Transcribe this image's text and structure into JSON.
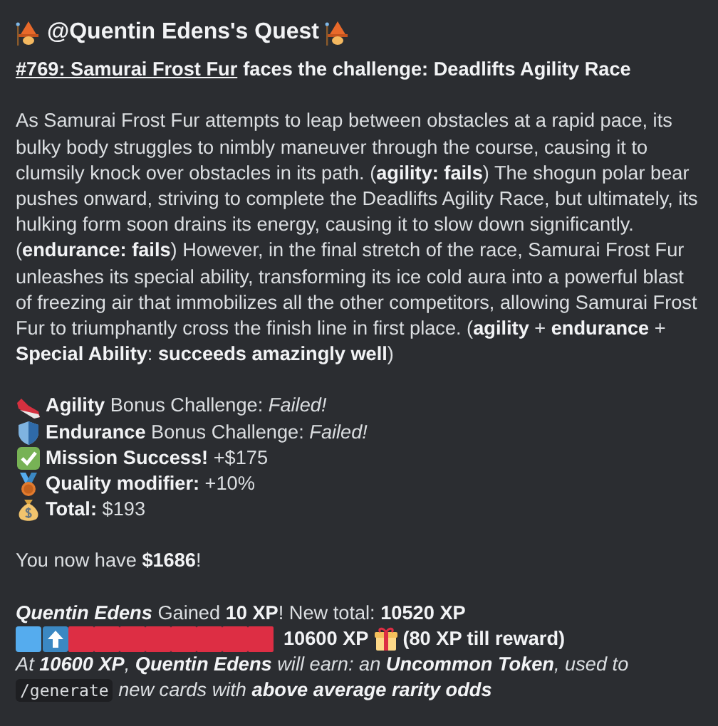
{
  "title": {
    "text": "@Quentin Edens's Quest"
  },
  "heading": {
    "link": "#769: Samurai Frost Fur",
    "text": "faces the challenge: Deadlifts Agility Race"
  },
  "story": "As Samurai Frost Fur attempts to leap between obstacles at a rapid pace, its bulky body struggles to nimbly maneuver through the course, causing it to clumsily knock over obstacles in its path. (**agility: fails**) The shogun polar bear pushes onward, striving to complete the Deadlifts Agility Race, but ultimately, its hulking form soon drains its energy, causing it to slow down significantly. (**endurance: fails**) However, in the final stretch of the race, Samurai Frost Fur unleashes its special ability, transforming its ice cold aura into a powerful blast of freezing air that immobilizes all the other competitors, allowing Samurai Frost Fur to triumphantly cross the finish line in first place. (**agility** + **endurance** + **Special Ability**: **succeeds amazingly well**)",
  "results": [
    {
      "kind": "sneaker",
      "text": "**Agility** Bonus Challenge: *Failed!*"
    },
    {
      "kind": "shield",
      "text": "**Endurance** Bonus Challenge: *Failed!*"
    },
    {
      "kind": "check",
      "text": "**Mission Success!** +$175"
    },
    {
      "kind": "medal",
      "text": "**Quality modifier:** +10%"
    },
    {
      "kind": "moneybag",
      "text": "**Total:** $193"
    }
  ],
  "balance": "You now have **$1686**!",
  "xp": {
    "name": "Quentin Edens",
    "text": "Gained **10 XP**! New total: **10520 XP**"
  },
  "xp_bar": [
    {
      "kind": "filled"
    },
    {
      "kind": "current"
    },
    {
      "kind": "empty"
    },
    {
      "kind": "empty"
    },
    {
      "kind": "empty"
    },
    {
      "kind": "empty"
    },
    {
      "kind": "empty"
    },
    {
      "kind": "empty"
    },
    {
      "kind": "empty"
    },
    {
      "kind": "empty"
    }
  ],
  "xp_target": "10600 XP",
  "xp_remaining": "(80 XP till reward)",
  "reward_note": {
    "before": "At **10600 XP**, **Quentin Edens** will earn: an **Uncommon Token**, used to",
    "command": "/generate",
    "after": "new cards with **above average rarity odds**"
  }
}
